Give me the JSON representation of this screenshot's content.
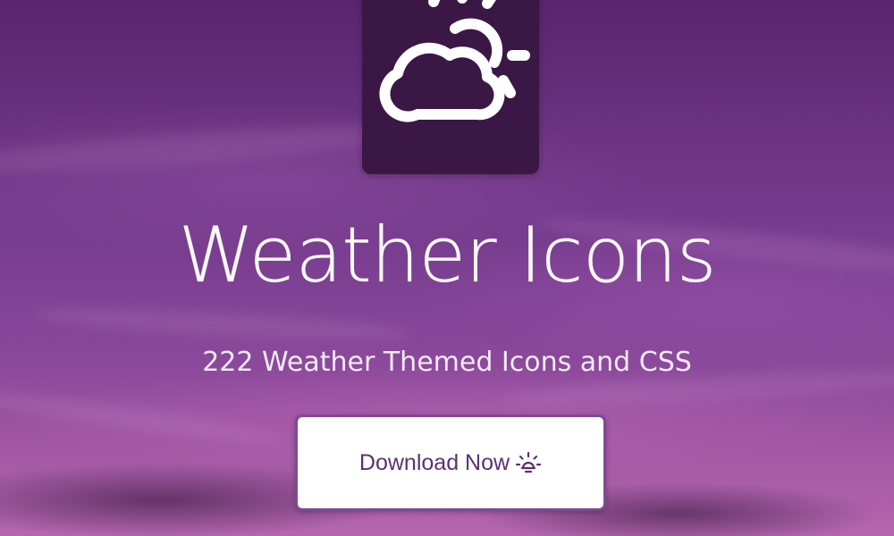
{
  "hero": {
    "title": "Weather Icons",
    "subtitle": "222 Weather Themed Icons and CSS"
  },
  "logo": {
    "icon": "day-cloudy-icon"
  },
  "download_button": {
    "label": "Download Now",
    "icon": "sunrise-icon"
  },
  "colors": {
    "accent": "#5e2f72",
    "tile": "#3b1746",
    "sky_top": "#5a2470",
    "sky_bottom": "#b466ad"
  }
}
